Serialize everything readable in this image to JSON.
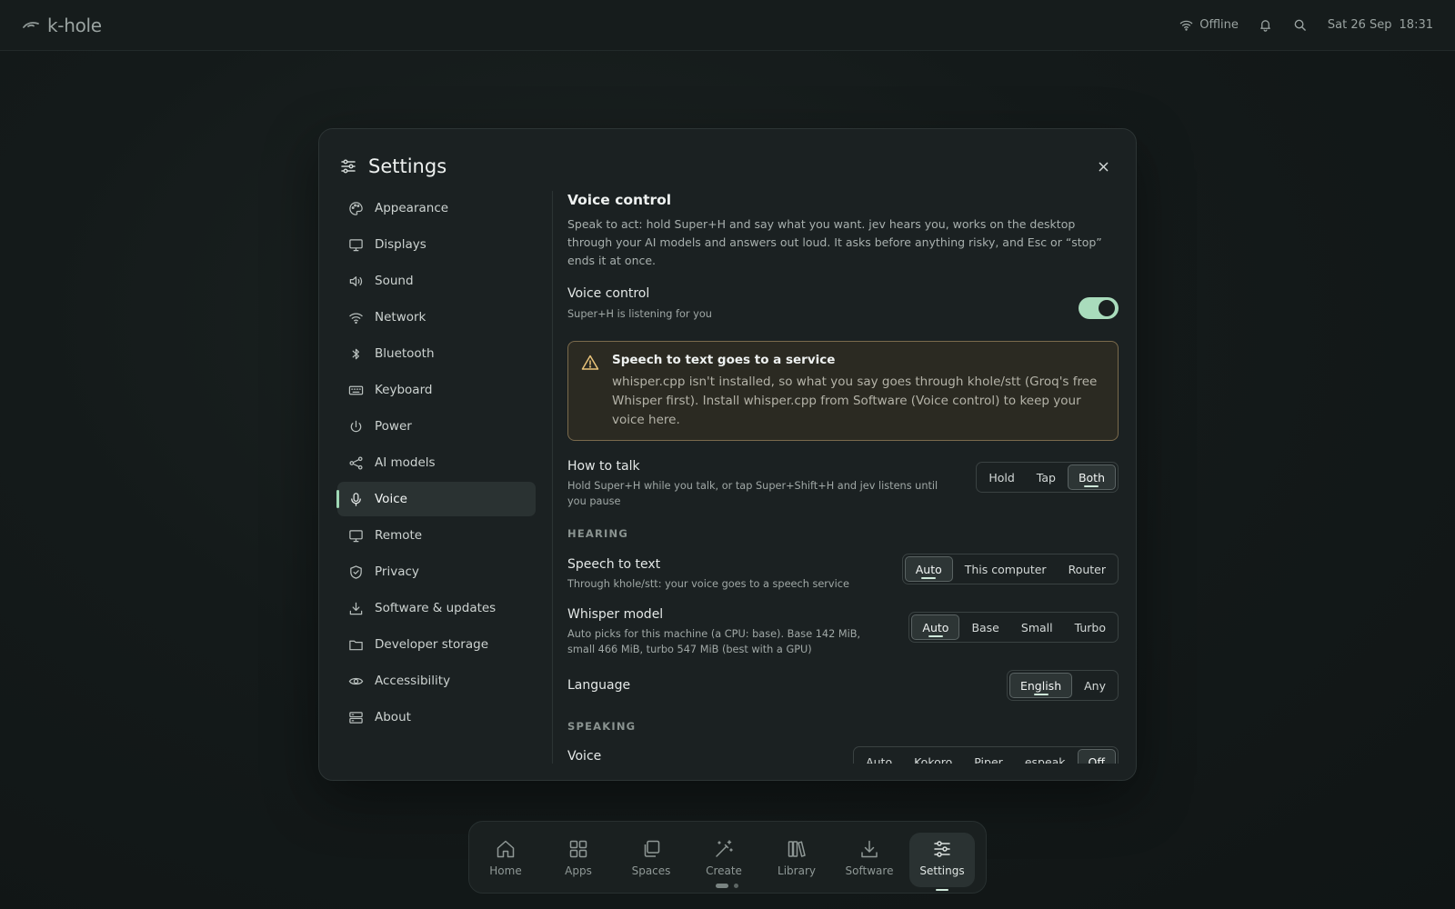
{
  "topbar": {
    "app_name": "k-hole",
    "network_status": "Offline",
    "date": "Sat 26 Sep",
    "time": "18:31"
  },
  "dialog": {
    "title": "Settings",
    "sidebar": [
      {
        "label": "Appearance",
        "icon": "palette-icon"
      },
      {
        "label": "Displays",
        "icon": "monitor-icon"
      },
      {
        "label": "Sound",
        "icon": "speaker-icon"
      },
      {
        "label": "Network",
        "icon": "wifi-icon"
      },
      {
        "label": "Bluetooth",
        "icon": "bluetooth-icon"
      },
      {
        "label": "Keyboard",
        "icon": "keyboard-icon"
      },
      {
        "label": "Power",
        "icon": "power-icon"
      },
      {
        "label": "AI models",
        "icon": "share-nodes-icon"
      },
      {
        "label": "Voice",
        "icon": "microphone-icon",
        "active": true
      },
      {
        "label": "Remote",
        "icon": "monitor-icon"
      },
      {
        "label": "Privacy",
        "icon": "shield-check-icon"
      },
      {
        "label": "Software & updates",
        "icon": "download-icon"
      },
      {
        "label": "Developer storage",
        "icon": "folder-icon"
      },
      {
        "label": "Accessibility",
        "icon": "eye-icon"
      },
      {
        "label": "About",
        "icon": "server-icon"
      }
    ],
    "voice_control": {
      "heading": "Voice control",
      "description": "Speak to act: hold Super+H and say what you want. jev hears you, works on the desktop through your AI models and answers out loud. It asks before anything risky, and Esc or “stop” ends it at once.",
      "toggle_label": "Voice control",
      "toggle_sub": "Super+H is listening for you",
      "toggle_on": true
    },
    "warning": {
      "title": "Speech to text goes to a service",
      "text": "whisper.cpp isn't installed, so what you say goes through khole/stt (Groq's free Whisper first). Install whisper.cpp from Software (Voice control) to keep your voice here.",
      "color": "#7a6a4c"
    },
    "how_to_talk": {
      "label": "How to talk",
      "sub": "Hold Super+H while you talk, or tap Super+Shift+H and jev listens until you pause",
      "options": [
        "Hold",
        "Tap",
        "Both"
      ],
      "selected": "Both"
    },
    "hearing_header": "HEARING",
    "speech_to_text": {
      "label": "Speech to text",
      "sub": "Through khole/stt: your voice goes to a speech service",
      "options": [
        "Auto",
        "This computer",
        "Router"
      ],
      "selected": "Auto"
    },
    "whisper_model": {
      "label": "Whisper model",
      "sub": "Auto picks for this machine (a CPU: base). Base 142 MiB, small 466 MiB, turbo 547 MiB (best with a GPU)",
      "options": [
        "Auto",
        "Base",
        "Small",
        "Turbo"
      ],
      "selected": "Auto"
    },
    "language": {
      "label": "Language",
      "options": [
        "English",
        "Any"
      ],
      "selected": "English"
    },
    "speaking_header": "SPEAKING",
    "voice": {
      "label": "Voice",
      "options": [
        "Auto",
        "Kokoro",
        "Piper",
        "espeak",
        "Off"
      ],
      "selected": "Off"
    }
  },
  "dock": [
    {
      "label": "Home",
      "icon": "home-icon"
    },
    {
      "label": "Apps",
      "icon": "grid-icon"
    },
    {
      "label": "Spaces",
      "icon": "layers-icon"
    },
    {
      "label": "Create",
      "icon": "magic-wand-icon"
    },
    {
      "label": "Library",
      "icon": "books-icon"
    },
    {
      "label": "Software",
      "icon": "download-icon"
    },
    {
      "label": "Settings",
      "icon": "sliders-icon",
      "active": true
    }
  ],
  "colors": {
    "accent": "#a9dcbc",
    "background": "#141a1a",
    "panel": "#1b2122"
  }
}
